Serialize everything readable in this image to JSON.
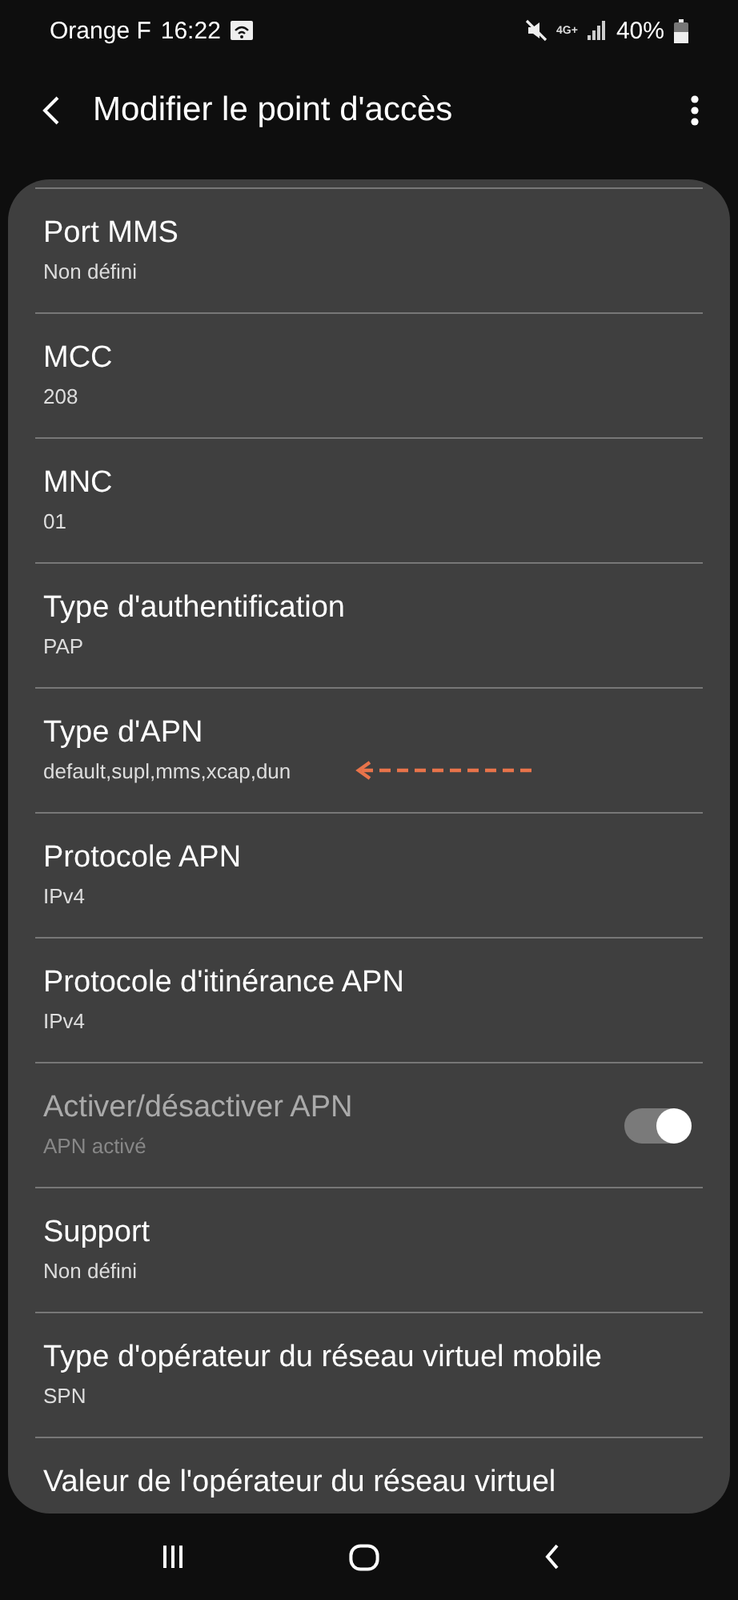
{
  "status_bar": {
    "carrier": "Orange F",
    "time": "16:22",
    "network": "4G+",
    "battery": "40%"
  },
  "header": {
    "title": "Modifier le point d'accès"
  },
  "settings": [
    {
      "kind": "value",
      "title": "Port MMS",
      "value": "Non défini",
      "disabled": false,
      "annotated": false
    },
    {
      "kind": "value",
      "title": "MCC",
      "value": "208",
      "disabled": false,
      "annotated": false
    },
    {
      "kind": "value",
      "title": "MNC",
      "value": "01",
      "disabled": false,
      "annotated": false
    },
    {
      "kind": "value",
      "title": "Type d'authentification",
      "value": "PAP",
      "disabled": false,
      "annotated": false
    },
    {
      "kind": "value",
      "title": "Type d'APN",
      "value": "default,supl,mms,xcap,dun",
      "disabled": false,
      "annotated": true
    },
    {
      "kind": "value",
      "title": "Protocole APN",
      "value": "IPv4",
      "disabled": false,
      "annotated": false
    },
    {
      "kind": "value",
      "title": "Protocole d'itinérance APN",
      "value": "IPv4",
      "disabled": false,
      "annotated": false
    },
    {
      "kind": "switch",
      "title": "Activer/désactiver APN",
      "value": "APN activé",
      "disabled": true,
      "on": true,
      "annotated": false
    },
    {
      "kind": "value",
      "title": "Support",
      "value": "Non défini",
      "disabled": false,
      "annotated": false
    },
    {
      "kind": "value",
      "title": "Type d'opérateur du réseau virtuel mobile",
      "value": "SPN",
      "disabled": false,
      "annotated": false
    },
    {
      "kind": "value",
      "title": "Valeur de l'opérateur du réseau virtuel",
      "disabled": false,
      "annotated": false
    }
  ]
}
